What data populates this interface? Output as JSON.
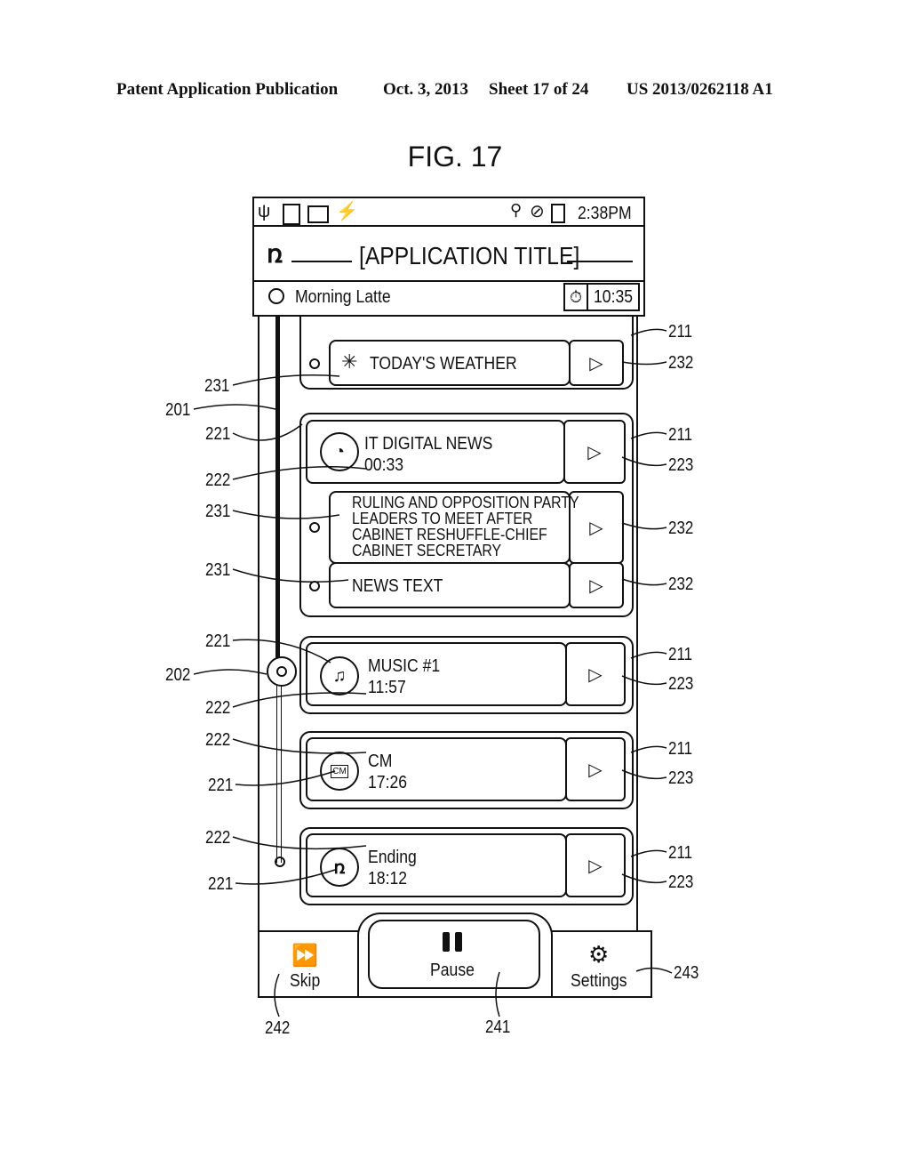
{
  "header": {
    "publication": "Patent Application Publication",
    "date": "Oct. 3, 2013",
    "sheet": "Sheet 17 of 24",
    "number": "US 2013/0262118 A1"
  },
  "figure_title": "FIG. 17",
  "status_bar": {
    "left_icons": [
      "usb-icon",
      "sd-card-icon",
      "bag-icon",
      "sync-icon"
    ],
    "right_icons": [
      "signal-icon",
      "no-entry-icon",
      "battery-charging-icon"
    ],
    "time": "2:38PM"
  },
  "title_bar": {
    "logo_icon": "app-logo-icon",
    "title": "[APPLICATION TITLE]"
  },
  "sub_bar": {
    "program_icon": "target-icon",
    "program_name": "Morning Latte",
    "timer_icon": "stopwatch-icon",
    "timer_value": "10:35"
  },
  "items": [
    {
      "type": "sub",
      "icon": "sun-icon",
      "title": "TODAY'S WEATHER",
      "play": "▷"
    },
    {
      "type": "main",
      "icon": "rss-icon",
      "title": "IT DIGITAL NEWS",
      "time": "00:33",
      "play": "▷"
    },
    {
      "type": "sub",
      "title_lines": [
        "RULING AND OPPOSITION PARTY",
        "LEADERS TO MEET AFTER",
        "CABINET RESHUFFLE-CHIEF",
        "CABINET SECRETARY"
      ],
      "play": "▷"
    },
    {
      "type": "sub",
      "title": "NEWS TEXT",
      "play": "▷"
    },
    {
      "type": "main",
      "icon": "music-note-icon",
      "title": "MUSIC #1",
      "time": "11:57",
      "play": "▷"
    },
    {
      "type": "main",
      "icon": "cm-tv-icon",
      "icon_text": "CM",
      "title": "CM",
      "time": "17:26",
      "play": "▷"
    },
    {
      "type": "main",
      "icon": "app-logo-icon",
      "title": "Ending",
      "time": "18:12",
      "play": "▷"
    }
  ],
  "bottom_bar": {
    "skip_label": "Skip",
    "pause_label": "Pause",
    "settings_label": "Settings"
  },
  "reference_labels": {
    "r211": "211",
    "r232": "232",
    "r231": "231",
    "r201": "201",
    "r221": "221",
    "r223": "223",
    "r222": "222",
    "r202": "202",
    "r243": "243",
    "r242": "242",
    "r241": "241"
  }
}
